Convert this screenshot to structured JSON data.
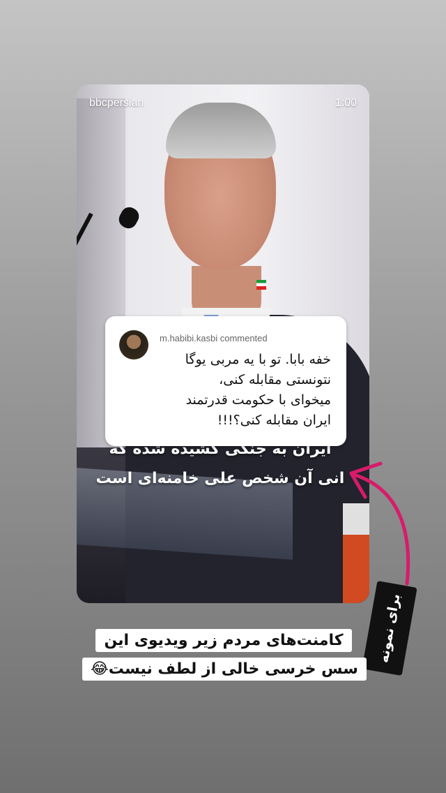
{
  "story": {
    "handle": "bbcpersian",
    "time": "1:00",
    "video_caption": [
      "ایران به جنگی کشیده شده که",
      "انی آن شخص علی خامنه‌ای است"
    ]
  },
  "comment": {
    "username": "m.habibi.kasbi commented",
    "lines": [
      "خفه بابا. تو با یه مربی یوگا",
      "نتونستی مقابله کنی،",
      "میخوای با حکومت قدرتمند",
      "ایران مقابله کنی؟!!!"
    ]
  },
  "sticker": {
    "label": "برای نمونه"
  },
  "overlay_text": {
    "line1": "کامنت‌های مردم زیر ویدیوی این",
    "line2": "سس خرسی خالی از لطف نیست😂"
  },
  "colors": {
    "arrow": "#d81b6a"
  }
}
